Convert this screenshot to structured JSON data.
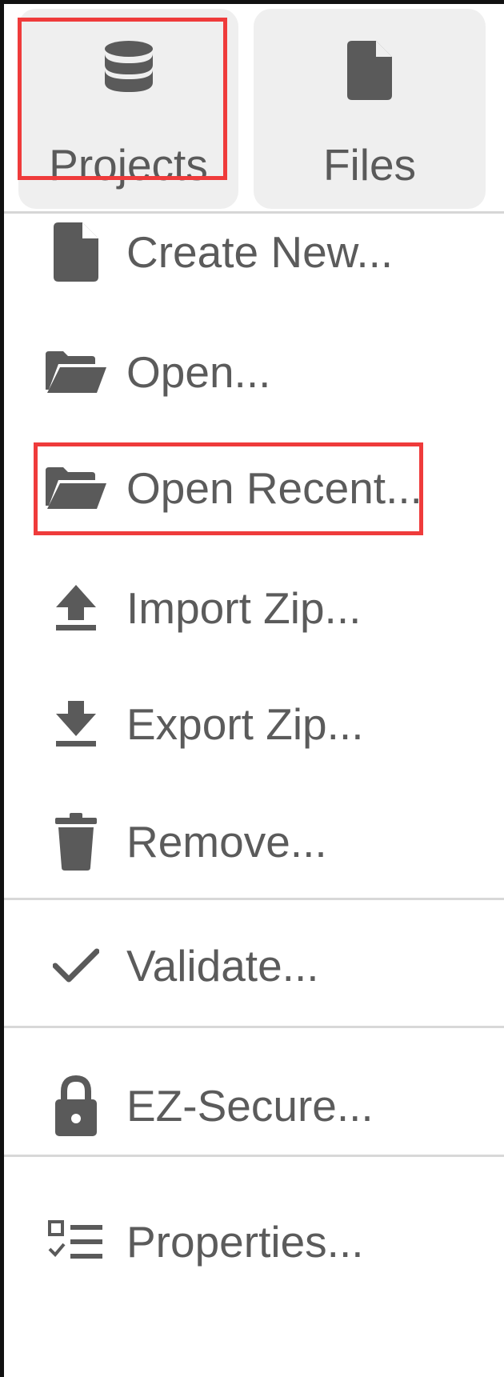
{
  "tabs": [
    {
      "label": "Projects",
      "icon": "database-icon",
      "selected": true
    },
    {
      "label": "Files",
      "icon": "file-icon",
      "selected": false
    }
  ],
  "menu": {
    "items": [
      {
        "label": "Create New...",
        "icon": "file-icon"
      },
      {
        "label": "Open...",
        "icon": "folder-open-icon"
      },
      {
        "label": "Open Recent...",
        "icon": "folder-open-icon",
        "highlighted": true
      },
      {
        "label": "Import Zip...",
        "icon": "upload-icon"
      },
      {
        "label": "Export Zip...",
        "icon": "download-icon"
      },
      {
        "label": "Remove...",
        "icon": "trash-icon"
      },
      {
        "label": "Validate...",
        "icon": "check-icon"
      },
      {
        "label": "EZ-Secure...",
        "icon": "lock-icon"
      },
      {
        "label": "Properties...",
        "icon": "checklist-icon"
      }
    ]
  },
  "colors": {
    "highlight": "#ef3b3b",
    "icon": "#5a5a5a",
    "text": "#5b5b5b",
    "tab_bg": "#efefef"
  }
}
